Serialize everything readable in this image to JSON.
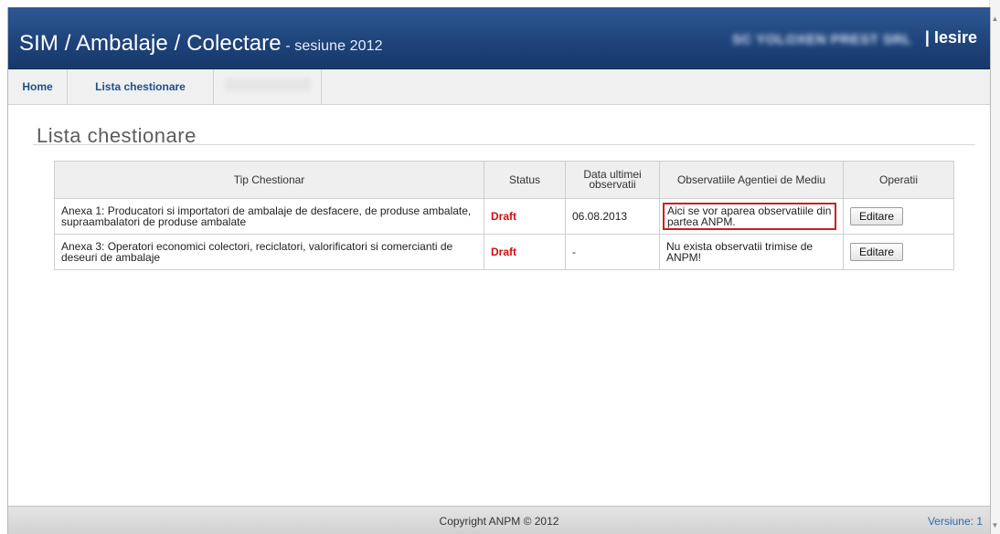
{
  "header": {
    "title": "SIM / Ambalaje / Colectare",
    "session": " - sesiune 2012",
    "company": "SC YOLOXEN PREST SRL",
    "logout_label": "| Iesire"
  },
  "nav": {
    "items": [
      {
        "label": "Home"
      },
      {
        "label": "Lista chestionare"
      }
    ]
  },
  "page": {
    "heading": "Lista chestionare"
  },
  "table": {
    "columns": [
      "Tip Chestionar",
      "Status",
      "Data ultimei observatii",
      "Observatiile Agentiei de Mediu",
      "Operatii"
    ],
    "rows": [
      {
        "tip": "Anexa 1: Producatori si importatori de ambalaje de desfacere, de produse ambalate, supraambalatori de produse ambalate",
        "status": "Draft",
        "date": "06.08.2013",
        "observatii": "Aici se vor aparea observatiile din partea ANPM.",
        "action": "Editare"
      },
      {
        "tip": "Anexa 3: Operatori economici colectori, reciclatori, valorificatori si comercianti de deseuri de ambalaje",
        "status": "Draft",
        "date": "-",
        "observatii": "Nu exista observatii trimise de ANPM!",
        "action": "Editare"
      }
    ]
  },
  "footer": {
    "copyright": "Copyright ANPM © 2012",
    "version": "Versiune: 1"
  },
  "colors": {
    "header_blue": "#1f447b",
    "status_red": "#cc1111",
    "highlight_red": "#d11c1c",
    "link_blue": "#1d4f8c"
  }
}
